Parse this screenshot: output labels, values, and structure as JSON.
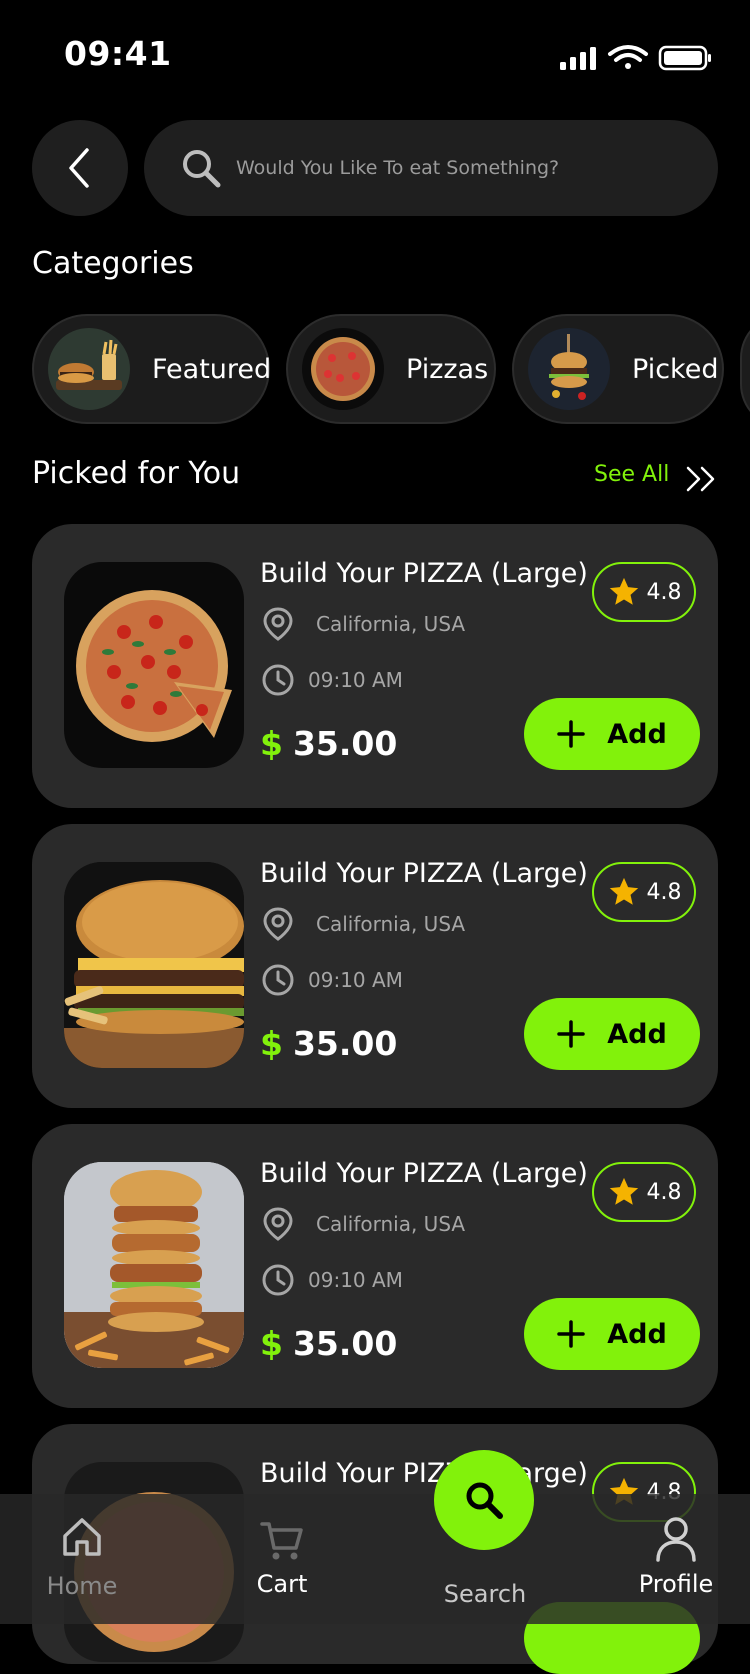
{
  "status_bar": {
    "time": "09:41"
  },
  "search": {
    "placeholder": "Would You Like To eat Something?"
  },
  "categories": {
    "title": "Categories",
    "items": [
      {
        "label": "Featured"
      },
      {
        "label": "Pizzas"
      },
      {
        "label": "Picked"
      }
    ]
  },
  "picked": {
    "title": "Picked for You",
    "see_all": "See All"
  },
  "cards": [
    {
      "title": "Build Your PIZZA (Large)",
      "location": "California, USA",
      "time": "09:10 AM",
      "currency": "$",
      "price": "35.00",
      "rating": "4.8",
      "add_label": "Add",
      "image": "pizza"
    },
    {
      "title": "Build Your PIZZA (Large)",
      "location": "California, USA",
      "time": "09:10 AM",
      "currency": "$",
      "price": "35.00",
      "rating": "4.8",
      "add_label": "Add",
      "image": "burger"
    },
    {
      "title": "Build Your PIZZA (Large)",
      "location": "California, USA",
      "time": "09:10 AM",
      "currency": "$",
      "price": "35.00",
      "rating": "4.8",
      "add_label": "Add",
      "image": "stacked-burger"
    },
    {
      "title": "Build Your PIZZA (Large)",
      "rating": "4.8",
      "image": "pizza-partial"
    }
  ],
  "nav": {
    "home": "Home",
    "cart": "Cart",
    "search": "Search",
    "profile": "Profile"
  },
  "colors": {
    "accent": "#82f20b",
    "card_bg": "#2a2a2a",
    "bg": "#000000",
    "star": "#f5b301"
  }
}
